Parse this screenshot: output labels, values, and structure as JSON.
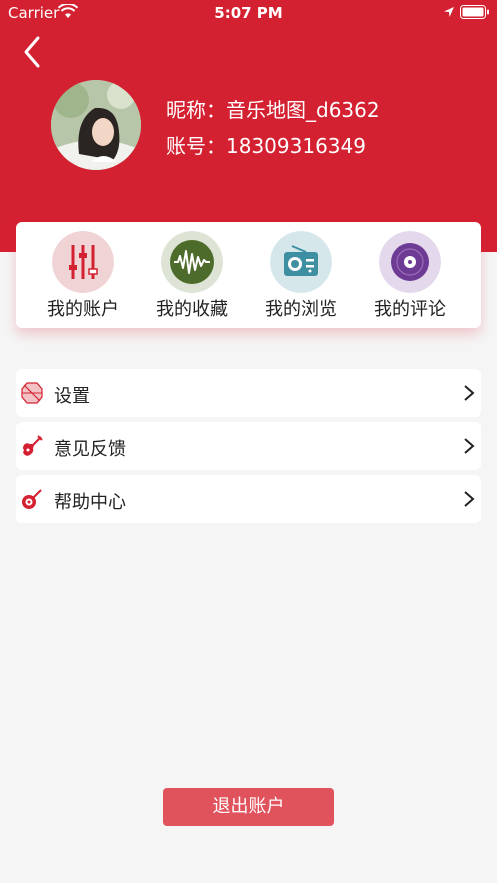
{
  "status_bar": {
    "carrier": "Carrier",
    "time": "5:07 PM"
  },
  "profile": {
    "nickname": "昵称：音乐地图_d6362",
    "account": "账号：18309316349"
  },
  "quick_actions": [
    {
      "label": "我的账户",
      "icon": "sliders-icon"
    },
    {
      "label": "我的收藏",
      "icon": "soundwave-icon"
    },
    {
      "label": "我的浏览",
      "icon": "radio-icon"
    },
    {
      "label": "我的评论",
      "icon": "vinyl-record-icon"
    }
  ],
  "menu": [
    {
      "label": "设置",
      "icon": "settings-icon"
    },
    {
      "label": "意见反馈",
      "icon": "guitar-icon"
    },
    {
      "label": "帮助中心",
      "icon": "banjo-icon"
    }
  ],
  "logout_label": "退出账户",
  "colors": {
    "brand": "#d42131",
    "logout": "#e0525c",
    "background": "#f5f5f5"
  }
}
